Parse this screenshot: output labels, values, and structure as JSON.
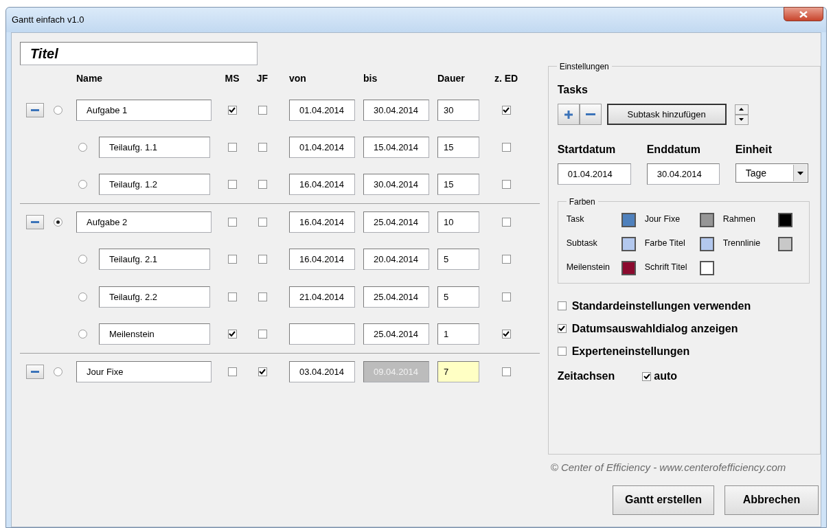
{
  "window": {
    "title": "Gantt einfach v1.0"
  },
  "title_field": {
    "value": "Titel"
  },
  "columns": [
    "Name",
    "MS",
    "JF",
    "von",
    "bis",
    "Dauer",
    "z. ED"
  ],
  "rows": [
    {
      "kind": "task",
      "selected": false,
      "name": "Aufgabe 1",
      "ms": true,
      "jf": false,
      "von": "01.04.2014",
      "bis": "30.04.2014",
      "dauer": "30",
      "z_ed": true,
      "bis_disabled": false,
      "dauer_highlighted": false
    },
    {
      "kind": "subtask",
      "selected": false,
      "name": "Teilaufg. 1.1",
      "ms": false,
      "jf": false,
      "von": "01.04.2014",
      "bis": "15.04.2014",
      "dauer": "15",
      "z_ed": false,
      "bis_disabled": false,
      "dauer_highlighted": false
    },
    {
      "kind": "subtask",
      "selected": false,
      "name": "Teilaufg. 1.2",
      "ms": false,
      "jf": false,
      "von": "16.04.2014",
      "bis": "30.04.2014",
      "dauer": "15",
      "z_ed": false,
      "bis_disabled": false,
      "dauer_highlighted": false
    },
    {
      "kind": "task",
      "selected": true,
      "name": "Aufgabe 2",
      "ms": false,
      "jf": false,
      "von": "16.04.2014",
      "bis": "25.04.2014",
      "dauer": "10",
      "z_ed": false,
      "bis_disabled": false,
      "dauer_highlighted": false
    },
    {
      "kind": "subtask",
      "selected": false,
      "name": "Teilaufg. 2.1",
      "ms": false,
      "jf": false,
      "von": "16.04.2014",
      "bis": "20.04.2014",
      "dauer": "5",
      "z_ed": false,
      "bis_disabled": false,
      "dauer_highlighted": false
    },
    {
      "kind": "subtask",
      "selected": false,
      "name": "Teilaufg. 2.2",
      "ms": false,
      "jf": false,
      "von": "21.04.2014",
      "bis": "25.04.2014",
      "dauer": "5",
      "z_ed": false,
      "bis_disabled": false,
      "dauer_highlighted": false
    },
    {
      "kind": "subtask",
      "selected": false,
      "name": "Meilenstein",
      "ms": true,
      "jf": false,
      "bis": "25.04.2014",
      "dauer": "1",
      "z_ed": true,
      "bis_disabled": false,
      "dauer_highlighted": false
    },
    {
      "kind": "task",
      "selected": false,
      "name": "Jour Fixe",
      "ms": false,
      "jf": true,
      "von": "03.04.2014",
      "bis": "09.04.2014",
      "dauer": "7",
      "z_ed": false,
      "bis_disabled": true,
      "dauer_highlighted": true
    }
  ],
  "settings": {
    "legend": "Einstellungen",
    "tasks_label": "Tasks",
    "subtask_button": "Subtask hinzufügen",
    "start": {
      "label": "Startdatum",
      "value": "01.04.2014"
    },
    "end": {
      "label": "Enddatum",
      "value": "30.04.2014"
    },
    "unit": {
      "label": "Einheit",
      "value": "Tage"
    },
    "colors": {
      "legend": "Farben",
      "items": [
        {
          "label": "Task",
          "color": "#4f81bd"
        },
        {
          "label": "Jour Fixe",
          "color": "#969696"
        },
        {
          "label": "Rahmen",
          "color": "#000000"
        },
        {
          "label": "Subtask",
          "color": "#b3c8ee"
        },
        {
          "label": "Farbe Titel",
          "color": "#b3c8ee"
        },
        {
          "label": "Trennlinie",
          "color": "#c8c8c8"
        },
        {
          "label": "Meilenstein",
          "color": "#8b0a2e"
        },
        {
          "label": "Schrift Titel",
          "color": "#ffffff"
        }
      ]
    },
    "options": [
      {
        "label": "Standardeinstellungen verwenden",
        "checked": false
      },
      {
        "label": "Datumsauswahldialog anzeigen",
        "checked": true
      },
      {
        "label": "Experteneinstellungen",
        "checked": false
      }
    ],
    "timeline": {
      "label": "Zeitachsen",
      "auto_label": "auto",
      "auto_checked": true
    }
  },
  "copyright": "© Center of Efficiency - www.centerofefficiency.com",
  "buttons": [
    "Gantt erstellen",
    "Abbrechen"
  ]
}
